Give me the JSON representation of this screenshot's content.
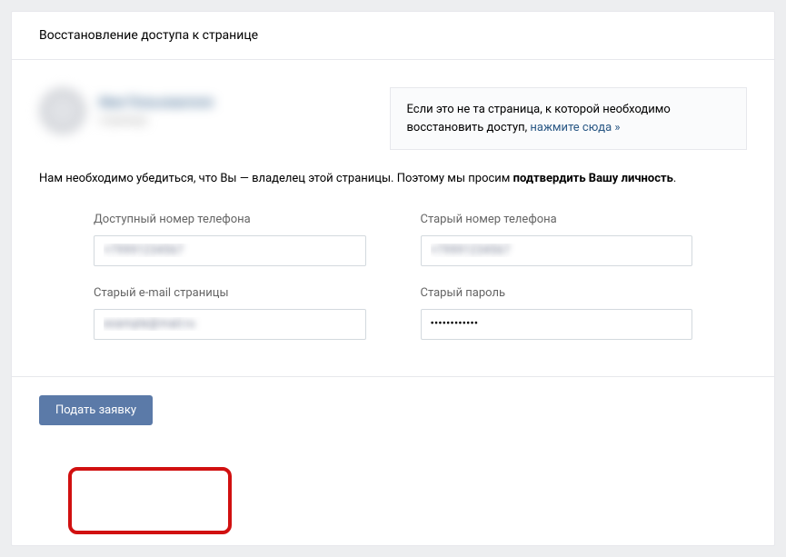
{
  "header": {
    "title": "Восстановление доступа к странице"
  },
  "user": {
    "name": "Имя Пользователя",
    "sub": "страница"
  },
  "notice": {
    "text_before": "Если это не та страница, к которой необходимо восстановить доступ, ",
    "link_text": "нажмите сюда »"
  },
  "description": {
    "text_before": "Нам необходимо убедиться, что Вы — владелец этой страницы. Поэтому мы просим ",
    "bold": "подтвердить Вашу личность",
    "text_after": "."
  },
  "fields": {
    "available_phone": {
      "label": "Доступный номер телефона",
      "value": "+79991234567"
    },
    "old_phone": {
      "label": "Старый номер телефона",
      "value": "+79991234567"
    },
    "old_email": {
      "label": "Старый e-mail страницы",
      "value": "example@mail.ru"
    },
    "old_password": {
      "label": "Старый пароль",
      "value": "••••••••••••"
    }
  },
  "submit": {
    "label": "Подать заявку"
  }
}
